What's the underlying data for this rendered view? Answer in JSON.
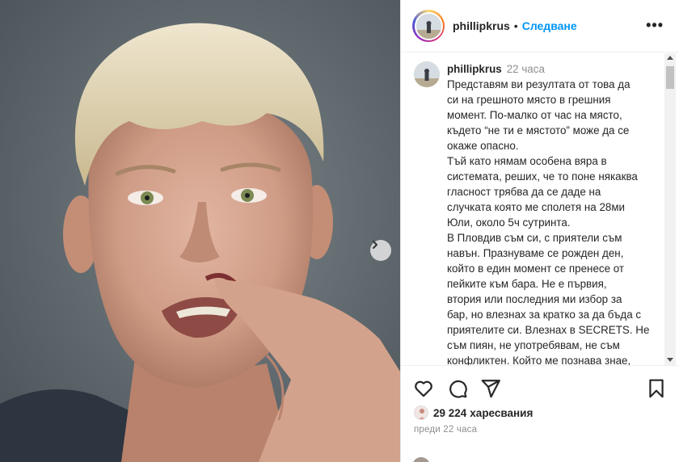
{
  "post": {
    "username": "phillipkrus",
    "dot": "•",
    "follow_label": "Следване",
    "more_label": "•••"
  },
  "caption": {
    "username": "phillipkrus",
    "time": "22 часа",
    "lines": [
      "Представям ви резултата от това да",
      "си на грешното място в грешния",
      "момент. По-малко от час на място,",
      "където “не ти е мястото” може да се",
      "окаже опасно.",
      "Тъй като нямам особена вяра в",
      "системата, реших, че то поне някаква",
      "гласност трябва да се даде на",
      "случката която ме сполетя на 28ми",
      "Юли, около 5ч сутринта.",
      "В Пловдив съм си, с приятели съм",
      "навън. Празнуваме се рожден ден,",
      "който в един момент се пренесе от",
      "пейките към бара. Не е първия,",
      "втория или последния ми избор за",
      "бар, но влезнах за кратко за да бъда с",
      "приятелите си. Влезнах в SECRETS. Не",
      "съм пиян, не употребявам, не съм",
      "конфликтен. Който ме познава знае,"
    ]
  },
  "likes": {
    "count": "29 224",
    "label": "харесвания"
  },
  "posted_ago": "преди 22 часа",
  "icons": {
    "like": "heart-icon",
    "comment": "comment-icon",
    "share": "share-icon",
    "save": "bookmark-icon",
    "next": "chevron-right-icon"
  },
  "colors": {
    "accent": "#0095f6",
    "text": "#262626",
    "muted": "#8e8e8e"
  }
}
